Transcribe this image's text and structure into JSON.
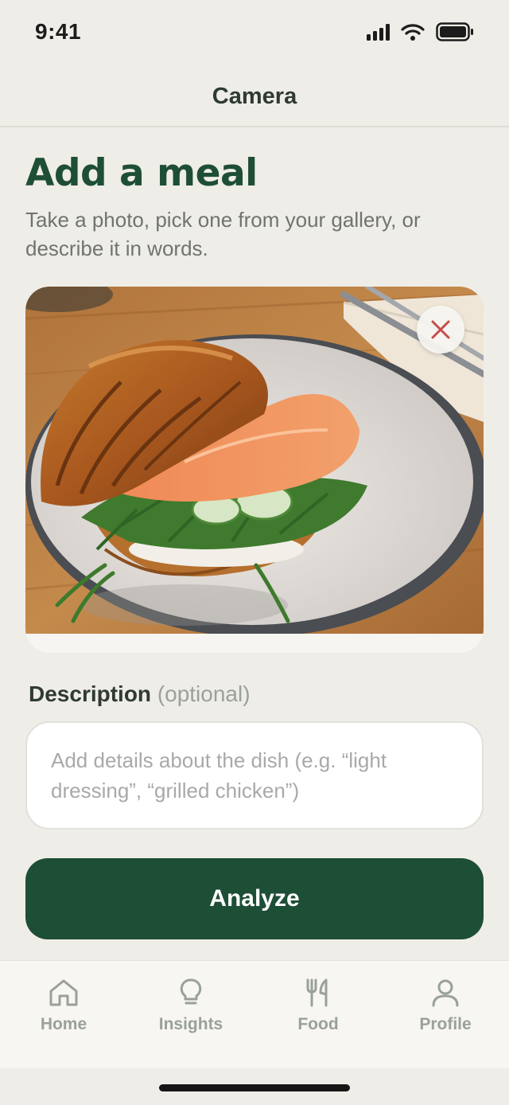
{
  "status_bar": {
    "time": "9:41"
  },
  "header": {
    "title": "Camera"
  },
  "main": {
    "title": "Add a meal",
    "subtitle": "Take a photo, pick one from your gallery, or describe it in words.",
    "description": {
      "label": "Description",
      "optional": "(optional)",
      "placeholder": "Add details about the dish (e.g. “light dressing”, “grilled chicken”)"
    },
    "analyze_label": "Analyze"
  },
  "tabs": [
    {
      "label": "Home",
      "icon": "home-icon"
    },
    {
      "label": "Insights",
      "icon": "lightbulb-icon"
    },
    {
      "label": "Food",
      "icon": "fork-knife-icon"
    },
    {
      "label": "Profile",
      "icon": "person-icon"
    }
  ],
  "colors": {
    "accent": "#1d4e36",
    "background": "#efede7",
    "remove_icon": "#c84a4a"
  }
}
